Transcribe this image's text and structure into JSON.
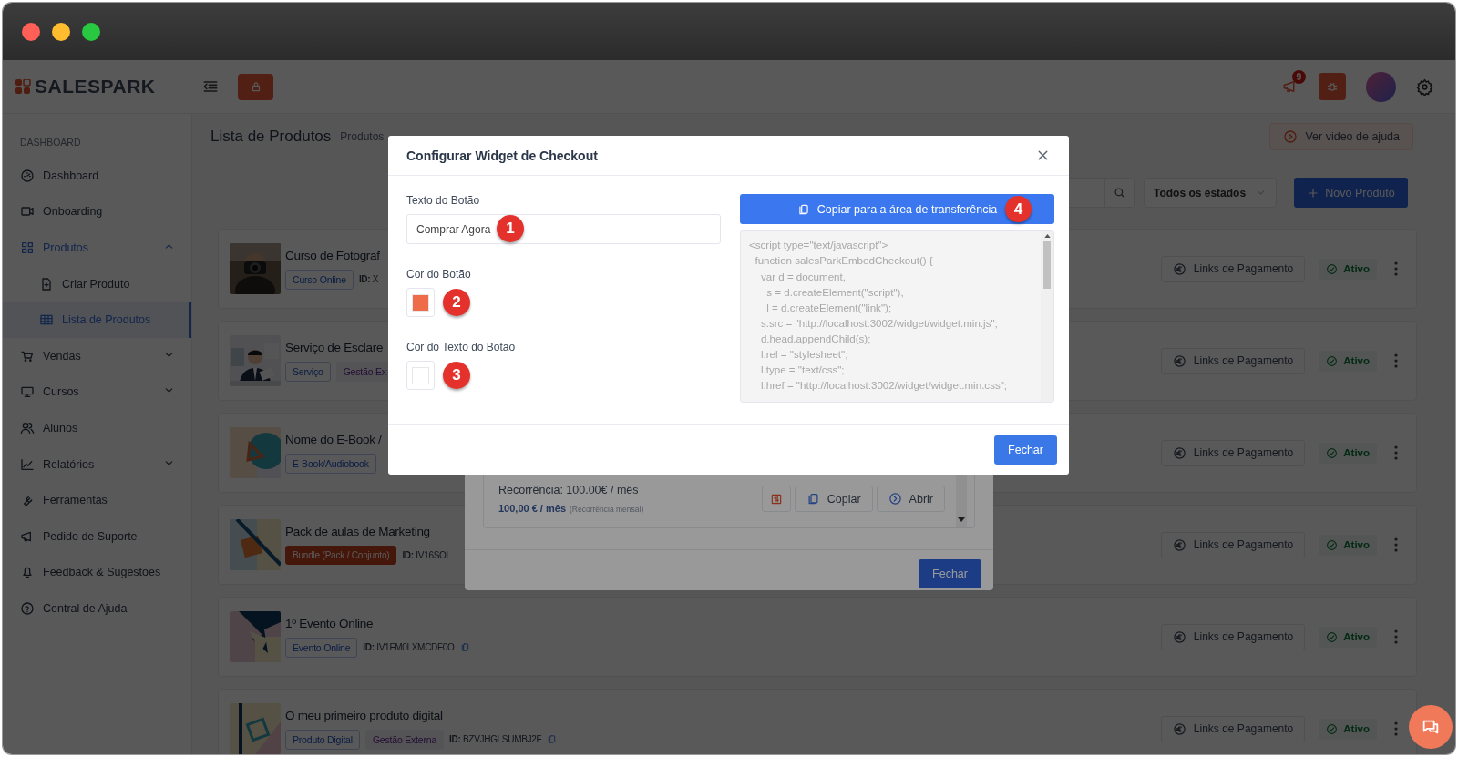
{
  "app": {
    "logo": "SALESPARK",
    "notification_count": "9"
  },
  "sidebar": {
    "section": "DASHBOARD",
    "items": [
      {
        "label": "Dashboard",
        "selected": false
      },
      {
        "label": "Onboarding",
        "selected": false
      },
      {
        "label": "Produtos",
        "selected": true,
        "expanded": true,
        "children": [
          {
            "label": "Criar Produto",
            "selected": false
          },
          {
            "label": "Lista de Produtos",
            "selected": true
          }
        ]
      },
      {
        "label": "Vendas",
        "selected": false,
        "expanded": false
      },
      {
        "label": "Cursos",
        "selected": false,
        "expanded": false
      },
      {
        "label": "Alunos",
        "selected": false
      },
      {
        "label": "Relatórios",
        "selected": false,
        "expanded": false
      },
      {
        "label": "Ferramentas",
        "selected": false
      },
      {
        "label": "Pedido de Suporte",
        "selected": false
      },
      {
        "label": "Feedback & Sugestões",
        "selected": false
      },
      {
        "label": "Central de Ajuda",
        "selected": false
      }
    ]
  },
  "page": {
    "title": "Lista de Produtos",
    "breadcrumb": "Produtos",
    "help_button": "Ver video de ajuda",
    "status_filter": "Todos os estados",
    "new_button": "Novo Produto"
  },
  "products": [
    {
      "title": "Curso de Fotograf",
      "tags": [
        {
          "label": "Curso Online",
          "kind": "type"
        }
      ],
      "id": "**ID:** X",
      "links_button": "Links de Pagamento",
      "status": "Ativo"
    },
    {
      "title": "Serviço de Esclare",
      "tags": [
        {
          "label": "Serviço",
          "kind": "type"
        },
        {
          "label": "Gestão Ex",
          "kind": "external"
        }
      ],
      "links_button": "Links de Pagamento",
      "status": "Ativo"
    },
    {
      "title": "Nome do E-Book /",
      "tags": [
        {
          "label": "E-Book/Audiobook",
          "kind": "type"
        }
      ],
      "links_button": "Links de Pagamento",
      "status": "Ativo"
    },
    {
      "title": "Pack de aulas de Marketing",
      "tags": [
        {
          "label": "Bundle (Pack / Conjunto)",
          "kind": "bundle"
        }
      ],
      "id": "**ID:** IV16SOL",
      "links_button": "Links de Pagamento",
      "status": "Ativo"
    },
    {
      "title": "1º Evento Online",
      "tags": [
        {
          "label": "Evento Online",
          "kind": "type"
        }
      ],
      "id": "**ID:** IV1FM0LXMCDF0O",
      "copy_icon": true,
      "links_button": "Links de Pagamento",
      "status": "Ativo"
    },
    {
      "title": "O meu primeiro produto digital",
      "tags": [
        {
          "label": "Produto Digital",
          "kind": "type"
        },
        {
          "label": "Gestão Externa",
          "kind": "external"
        }
      ],
      "id": "**ID:** BZVJHGLSUMBJ2F",
      "copy_icon": true,
      "links_button": "Links de Pagamento",
      "status": "Ativo"
    }
  ],
  "background_dialog": {
    "recurrence": "Recorrência: 100.00€ / mês",
    "price": "100,00 € / mês",
    "price_note": "(Recorrência mensal)",
    "copy_button": "Copiar",
    "open_button": "Abrir",
    "close_button": "Fechar"
  },
  "dialog": {
    "title": "Configurar Widget de Checkout",
    "fields": [
      {
        "kind": "text",
        "label": "Texto do Botão",
        "value": "Comprar Agora",
        "marker": "1"
      },
      {
        "kind": "color",
        "label": "Cor do Botão",
        "color": "#ef6c4a",
        "marker": "2"
      },
      {
        "kind": "color",
        "label": "Cor do Texto do Botão",
        "color": "#ffffff",
        "marker": "3"
      }
    ],
    "copy_button": "Copiar para a área de transferência",
    "copy_marker": "4",
    "code": [
      "<script type=\"text/javascript\">",
      "  function salesParkEmbedCheckout() {",
      "    var d = document,",
      "      s = d.createElement(\"script\"),",
      "      l = d.createElement(\"link\");",
      "    s.src = \"http://localhost:3002/widget/widget.min.js\";",
      "    d.head.appendChild(s);",
      "    l.rel = \"stylesheet\";",
      "    l.type = \"text/css\";",
      "    l.href = \"http://localhost:3002/widget/widget.min.css\";"
    ],
    "close_button": "Fechar"
  }
}
